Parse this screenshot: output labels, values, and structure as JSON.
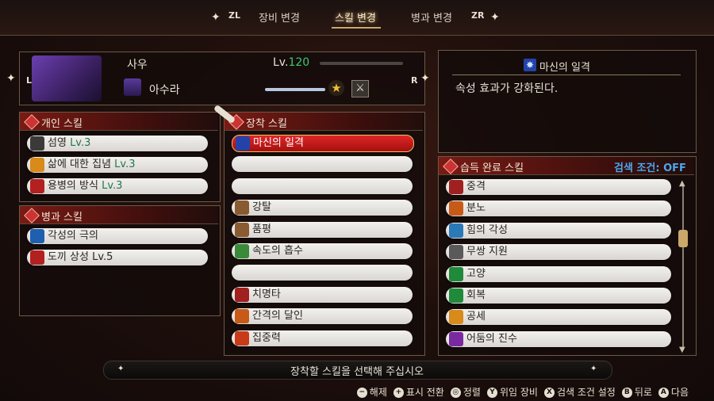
{
  "tabs": {
    "left_key": "ZL",
    "right_key": "ZR",
    "items": [
      "장비 변경",
      "스킬 변경",
      "병과 변경"
    ],
    "active": "스킬 변경"
  },
  "character": {
    "name": "사우",
    "level_label": "Lv.",
    "level": "120",
    "class_name": "아수라",
    "nav_left": "L",
    "nav_right": "R"
  },
  "detail": {
    "skill_name": "마신의 일격",
    "description": "속성 효과가 강화된다."
  },
  "personal_skills": {
    "title": "개인 스킬",
    "items": [
      {
        "name": "섬영 ",
        "lv": "Lv.3",
        "icon_color": "#3a3a3a"
      },
      {
        "name": "삶에 대한 집념 ",
        "lv": "Lv.3",
        "icon_color": "#d88a1a"
      },
      {
        "name": "용병의 방식 ",
        "lv": "Lv.3",
        "icon_color": "#b22020"
      }
    ]
  },
  "class_skills": {
    "title": "병과 스킬",
    "items": [
      {
        "name": "각성의 극의",
        "icon_color": "#1f5fb0"
      },
      {
        "name": "도끼 상성 Lv.5",
        "icon_color": "#b22020"
      }
    ]
  },
  "equipped_skills": {
    "title": "장착 스킬",
    "items": [
      {
        "name": "마신의 일격",
        "icon_color": "#2244aa",
        "selected": true
      },
      {
        "name": ""
      },
      {
        "name": ""
      },
      {
        "name": "강탈",
        "icon_color": "#8a5a30"
      },
      {
        "name": "품평",
        "icon_color": "#8a5a30"
      },
      {
        "name": "속도의 흡수",
        "icon_color": "#3a8a3a"
      },
      {
        "name": ""
      },
      {
        "name": "치명타",
        "icon_color": "#a02020"
      },
      {
        "name": "간격의 달인",
        "icon_color": "#c85a18"
      },
      {
        "name": "집중력",
        "icon_color": "#c83a18"
      }
    ]
  },
  "learned_skills": {
    "title": "습득 완료 스킬",
    "filter_label": "검색 조건: OFF",
    "items": [
      {
        "name": "중격",
        "icon_color": "#a02020"
      },
      {
        "name": "분노",
        "icon_color": "#c85a18"
      },
      {
        "name": "힘의 각성",
        "icon_color": "#2a7ab8"
      },
      {
        "name": "무쌍 지원",
        "icon_color": "#5a5a5a"
      },
      {
        "name": "고양",
        "icon_color": "#1f8a3a"
      },
      {
        "name": "회복",
        "icon_color": "#1f8a3a"
      },
      {
        "name": "공세",
        "icon_color": "#d88a1a"
      },
      {
        "name": "어둠의 진수",
        "icon_color": "#7a2aa0"
      }
    ]
  },
  "footer": {
    "message": "장착할 스킬을 선택해 주십시오",
    "hints": [
      {
        "key": "−",
        "label": "해제"
      },
      {
        "key": "+",
        "label": "표시 전환"
      },
      {
        "key": "◎",
        "label": "정렬"
      },
      {
        "key": "Y",
        "label": "위임 장비"
      },
      {
        "key": "X",
        "label": "검색 조건 설정"
      },
      {
        "key": "B",
        "label": "뒤로"
      },
      {
        "key": "A",
        "label": "다음"
      }
    ]
  }
}
